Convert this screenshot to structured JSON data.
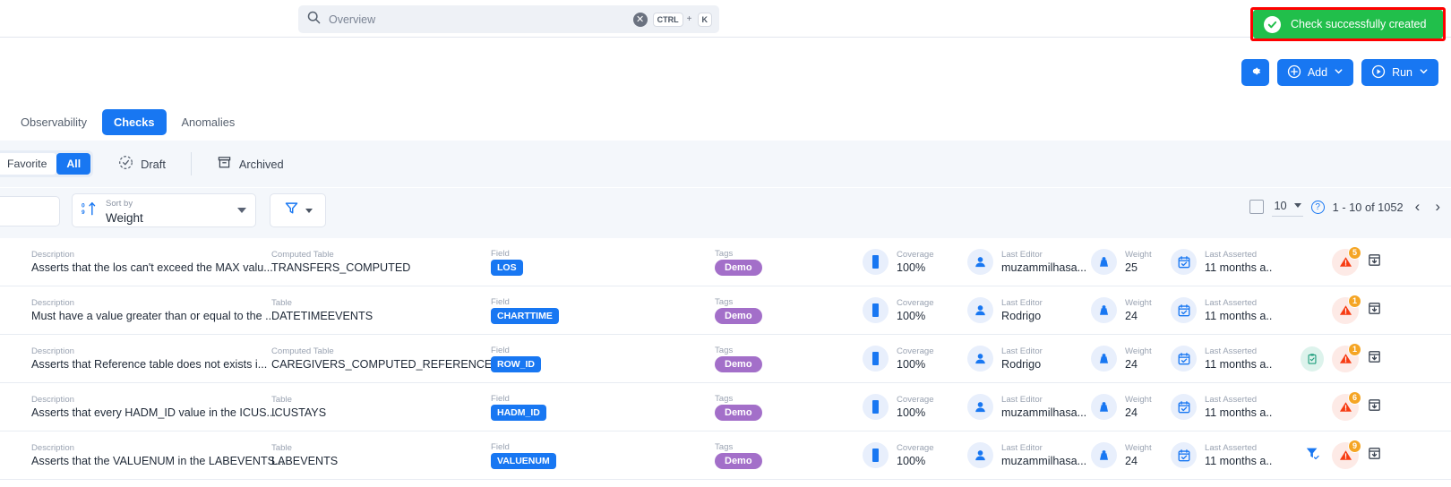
{
  "search": {
    "value": "Overview",
    "placeholder": "Overview",
    "clear_label": "✕",
    "kbd1": "CTRL",
    "kbd_plus": "+",
    "kbd2": "K",
    "icon": "search-icon"
  },
  "toast": {
    "text": "Check successfully created",
    "icon": "check-circle-icon",
    "bg": "#21bf4b",
    "highlight": "#ff0000"
  },
  "actions": {
    "settings_label": "",
    "add_label": "Add",
    "run_label": "Run",
    "accent": "#1877f2"
  },
  "tabs": [
    {
      "label": "Observability",
      "active": false
    },
    {
      "label": "Checks",
      "active": true
    },
    {
      "label": "Anomalies",
      "active": false
    }
  ],
  "filters": {
    "segments": [
      {
        "label": "Favorite",
        "on": false
      },
      {
        "label": "All",
        "on": true
      }
    ],
    "draft": "Draft",
    "archived": "Archived"
  },
  "controls": {
    "search_value": "",
    "sort_caption": "Sort by",
    "sort_value": "Weight",
    "filter_icon": "funnel-icon"
  },
  "pager": {
    "page_size": "10",
    "range": "1 - 10 of 1052",
    "prev": "‹",
    "next": "›"
  },
  "columns": {
    "description": "Description",
    "table": "Table",
    "computed_table": "Computed Table",
    "field": "Field",
    "tags": "Tags",
    "coverage": "Coverage",
    "last_editor": "Last Editor",
    "weight": "Weight",
    "last_asserted": "Last Asserted"
  },
  "rows": [
    {
      "description": "Asserts that the los can't exceed the MAX valu...",
      "table_caption": "Computed Table",
      "table": "TRANSFERS_COMPUTED",
      "field": "LOS",
      "tag": "Demo",
      "coverage": "100%",
      "last_editor": "muzammilhasa...",
      "weight": "25",
      "last_asserted": "11 months a..",
      "alert_count": "5",
      "has_clipboard": false,
      "has_filter": false
    },
    {
      "description": "Must have a value greater than or equal to the ...",
      "table_caption": "Table",
      "table": "DATETIMEEVENTS",
      "field": "CHARTTIME",
      "tag": "Demo",
      "coverage": "100%",
      "last_editor": "Rodrigo",
      "weight": "24",
      "last_asserted": "11 months a..",
      "alert_count": "1",
      "has_clipboard": false,
      "has_filter": false
    },
    {
      "description": "Asserts that Reference table does not exists i...",
      "table_caption": "Computed Table",
      "table": "CAREGIVERS_COMPUTED_REFERENCE",
      "field": "ROW_ID",
      "tag": "Demo",
      "coverage": "100%",
      "last_editor": "Rodrigo",
      "weight": "24",
      "last_asserted": "11 months a..",
      "alert_count": "1",
      "has_clipboard": true,
      "has_filter": false
    },
    {
      "description": "Asserts that every HADM_ID value in the ICUS...",
      "table_caption": "Table",
      "table": "ICUSTAYS",
      "field": "HADM_ID",
      "tag": "Demo",
      "coverage": "100%",
      "last_editor": "muzammilhasa...",
      "weight": "24",
      "last_asserted": "11 months a..",
      "alert_count": "6",
      "has_clipboard": false,
      "has_filter": false
    },
    {
      "description": "Asserts that the VALUENUM in the LABEVENTS...",
      "table_caption": "Table",
      "table": "LABEVENTS",
      "field": "VALUENUM",
      "tag": "Demo",
      "coverage": "100%",
      "last_editor": "muzammilhasa...",
      "weight": "24",
      "last_asserted": "11 months a..",
      "alert_count": "9",
      "has_clipboard": false,
      "has_filter": true
    }
  ]
}
